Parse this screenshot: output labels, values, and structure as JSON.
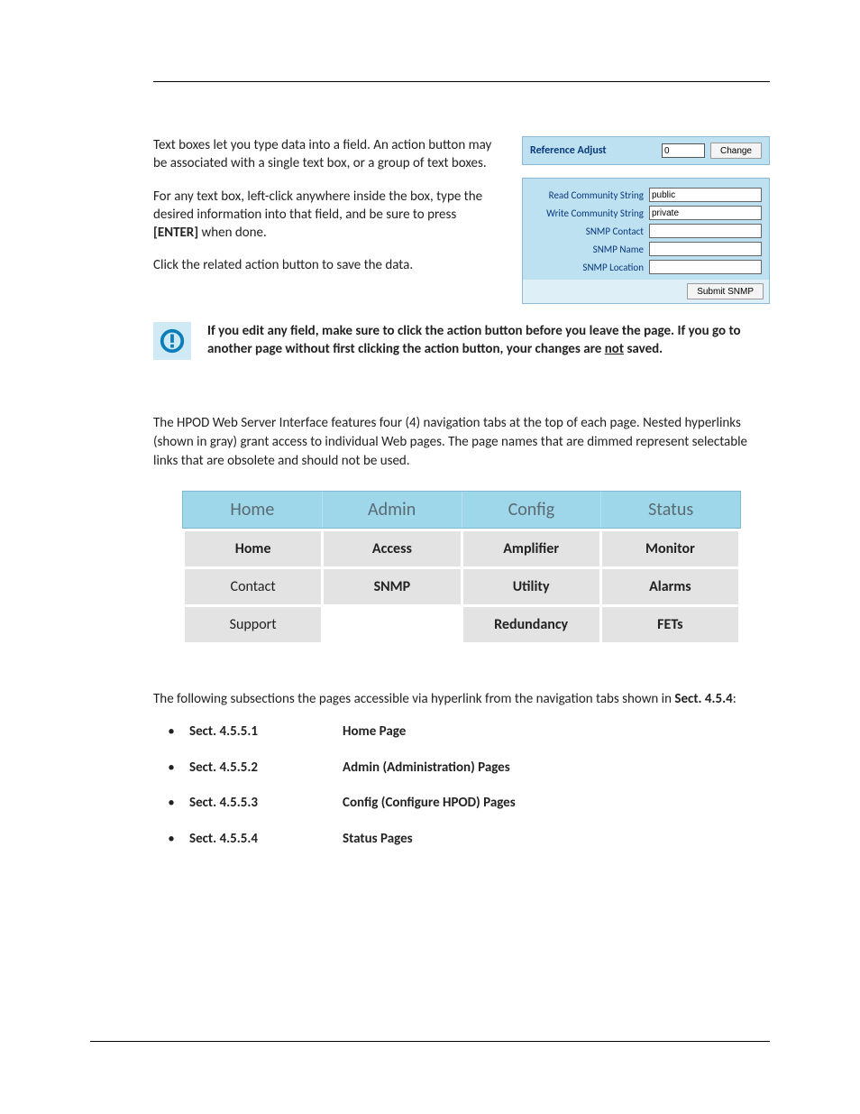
{
  "intro": {
    "p1": "Text boxes let you type data into a field. An action button may be associated with a single text box, or a group of text boxes.",
    "p2_before": "For any text box, left-click anywhere inside the box, type the desired information into that field, and be sure to press ",
    "p2_bold": "[ENTER]",
    "p2_after": " when done.",
    "p3": "Click the related action button to save the data."
  },
  "fig1": {
    "label": "Reference Adjust",
    "value": "0",
    "button": "Change"
  },
  "fig2": {
    "rows": [
      {
        "label": "Read Community String",
        "value": "public"
      },
      {
        "label": "Write Community String",
        "value": "private"
      },
      {
        "label": "SNMP Contact",
        "value": ""
      },
      {
        "label": "SNMP Name",
        "value": ""
      },
      {
        "label": "SNMP Location",
        "value": ""
      }
    ],
    "submit": "Submit SNMP"
  },
  "note": {
    "line1": "If you edit any field, make sure to click the action button before you leave the page. If you go to another page without first clicking the action button, your changes are ",
    "not": "not",
    "line2": " saved."
  },
  "nav_desc": "The HPOD Web Server Interface features four (4) navigation tabs at the top of each page. Nested hyperlinks (shown in gray) grant access to individual Web pages. The page names that are dimmed represent selectable links that are obsolete and should not be used.",
  "nav_tabs": [
    "Home",
    "Admin",
    "Config",
    "Status"
  ],
  "nav_grid": [
    [
      {
        "t": "Home",
        "b": true
      },
      {
        "t": "Access",
        "b": true
      },
      {
        "t": "Amplifier",
        "b": true
      },
      {
        "t": "Monitor",
        "b": true
      }
    ],
    [
      {
        "t": "Contact",
        "b": false
      },
      {
        "t": "SNMP",
        "b": true
      },
      {
        "t": "Utility",
        "b": true
      },
      {
        "t": "Alarms",
        "b": true
      }
    ],
    [
      {
        "t": "Support",
        "b": false
      },
      {
        "t": "",
        "b": false
      },
      {
        "t": "Redundancy",
        "b": true
      },
      {
        "t": "FETs",
        "b": true
      }
    ]
  ],
  "outline": {
    "intro_before": "The following subsections the pages accessible via hyperlink from the navigation tabs shown in ",
    "intro_ref": "Sect. 4.5.4",
    "intro_after": ":",
    "items": [
      {
        "num": "Sect. 4.5.5.1",
        "title": "Home Page"
      },
      {
        "num": "Sect. 4.5.5.2",
        "title": "Admin (Administration) Pages"
      },
      {
        "num": "Sect. 4.5.5.3",
        "title": "Config (Configure HPOD) Pages"
      },
      {
        "num": "Sect. 4.5.5.4",
        "title": "Status Pages"
      }
    ]
  }
}
